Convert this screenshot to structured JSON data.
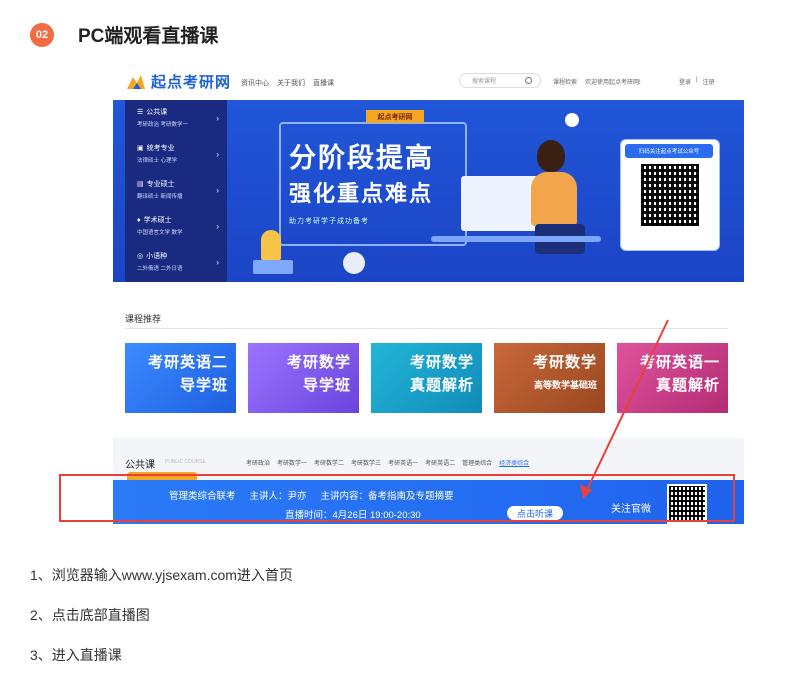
{
  "header": {
    "badge": "02",
    "title": "PC端观看直播课"
  },
  "site": {
    "logo_text": "起点考研网",
    "logo_sub": "yjsexam.com",
    "nav": [
      "资讯中心",
      "关于我们",
      "直播课"
    ],
    "search_placeholder": "搜索课程",
    "top_links": [
      "课程检索",
      "欢迎使用起点考研网!"
    ],
    "login": "登录",
    "register": "注册",
    "separator": "|"
  },
  "banner": {
    "menu": [
      {
        "title": "公共课",
        "sub": "考研政治  考研数学一"
      },
      {
        "title": "统考专业",
        "sub": "法律硕士  心理学"
      },
      {
        "title": "专业硕士",
        "sub": "翻译硕士  新闻传播"
      },
      {
        "title": "学术硕士",
        "sub": "中国语言文学  数学"
      },
      {
        "title": "小语种",
        "sub": "二外俄语  二外日语"
      }
    ],
    "tag": "起点考研网",
    "headline1": "分阶段提高",
    "headline2": "强化重点难点",
    "subline": "助力考研学子成功备考",
    "card_title": "扫码关注起点考试公众号"
  },
  "recommend": {
    "title": "课程推荐",
    "courses": [
      {
        "l1": "考研英语二",
        "l2": "导学班",
        "color": "#2a78f0"
      },
      {
        "l1": "考研数学",
        "l2": "导学班",
        "color": "#7a56e8"
      },
      {
        "l1": "考研数学",
        "l2": "真题解析",
        "color": "#17a0c9"
      },
      {
        "l1": "考研数学",
        "l2": "高等数学基础班",
        "color": "#b2582c"
      },
      {
        "l1": "考研英语一",
        "l2": "真题解析",
        "color": "#c93a86"
      }
    ]
  },
  "public_course": {
    "title": "公共课",
    "title_en": "PUBLIC COURSE",
    "tabs": [
      "考研政治",
      "考研数学一",
      "考研数学二",
      "考研数学三",
      "考研英语一",
      "考研英语二",
      "管理类综合",
      "经济类综合"
    ],
    "active_tab": 7
  },
  "live": {
    "course": "管理类综合联考",
    "speaker": "主讲人：尹亦",
    "content": "主讲内容：备考指南及专题摘要",
    "time": "直播时间：4月26日 19:00-20:30",
    "button": "点击听课",
    "follow": "关注官微"
  },
  "steps": [
    "1、浏览器输入www.yjsexam.com进入首页",
    "2、点击底部直播图",
    "3、进入直播课"
  ],
  "colors": {
    "accent": "#f26b43",
    "brand": "#1d63d6",
    "highlight": "#e8403a"
  }
}
